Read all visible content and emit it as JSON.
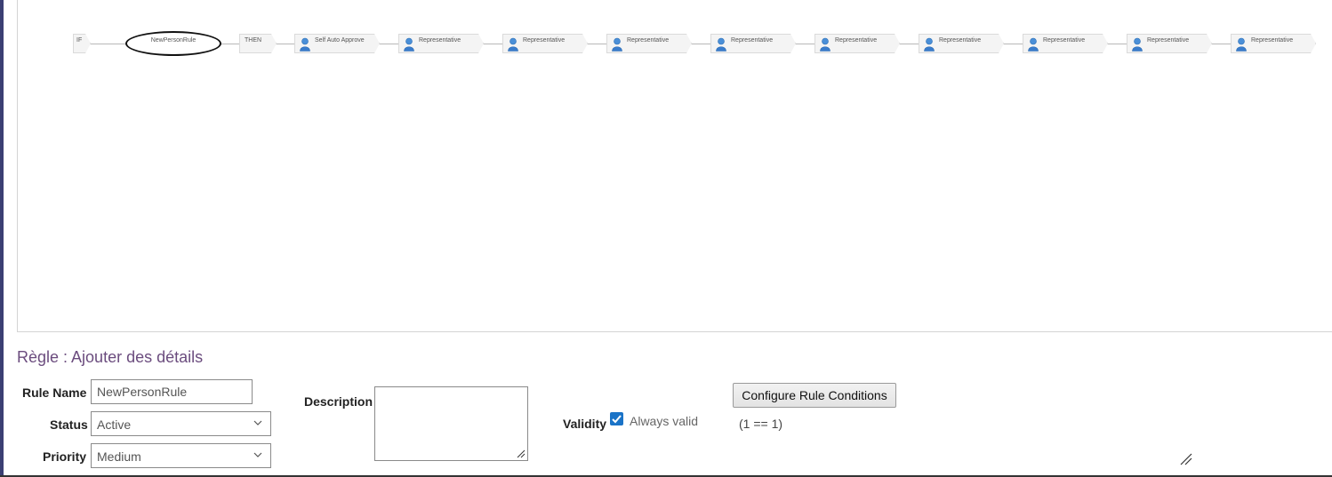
{
  "flow": {
    "if_label": "IF",
    "rule_label": "NewPersonRule",
    "then_label": "THEN",
    "approvers": [
      {
        "label": "Self Auto Approve",
        "icon": "person-icon"
      },
      {
        "label": "Representative",
        "icon": "person-icon"
      },
      {
        "label": "Representative",
        "icon": "person-icon"
      },
      {
        "label": "Representative",
        "icon": "person-icon"
      },
      {
        "label": "Representative",
        "icon": "person-icon"
      },
      {
        "label": "Representative",
        "icon": "person-icon"
      },
      {
        "label": "Representative",
        "icon": "person-icon"
      },
      {
        "label": "Representative",
        "icon": "person-icon"
      },
      {
        "label": "Representative",
        "icon": "person-icon"
      },
      {
        "label": "Representative",
        "icon": "person-icon"
      }
    ]
  },
  "details": {
    "title": "Règle : Ajouter des détails",
    "rule_name_label": "Rule Name",
    "rule_name_value": "NewPersonRule",
    "status_label": "Status",
    "status_value": "Active",
    "priority_label": "Priority",
    "priority_value": "Medium",
    "description_label": "Description",
    "description_value": "",
    "validity_label": "Validity",
    "always_valid_label": "Always valid",
    "always_valid_checked": true,
    "configure_button": "Configure Rule Conditions",
    "condition_expression": "(1 == 1)"
  },
  "colors": {
    "accent_title": "#6b4c7e",
    "checkbox": "#1a73c7",
    "sidebar": "#3b3f73"
  }
}
